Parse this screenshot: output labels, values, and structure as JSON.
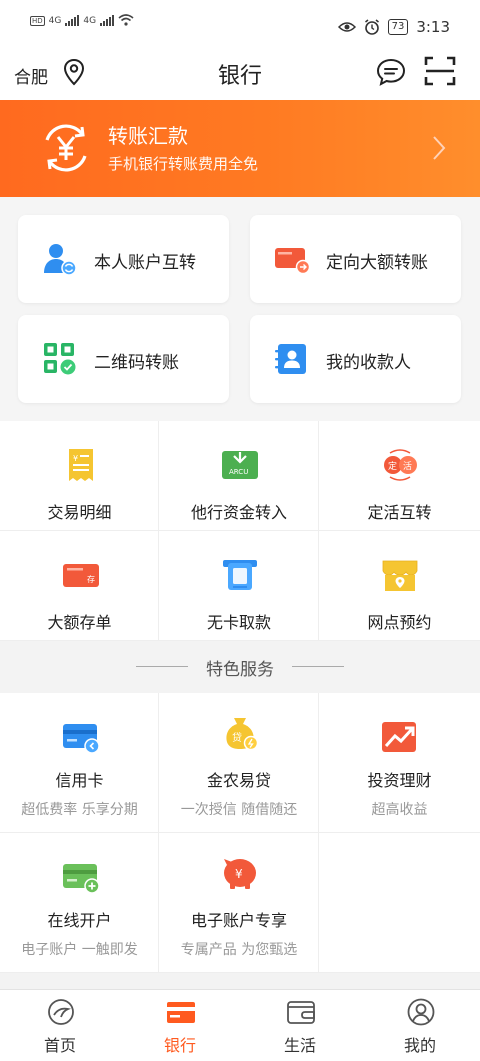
{
  "status_bar": {
    "net1": "4G",
    "net2": "4G",
    "battery": "73",
    "time": "3:13"
  },
  "header": {
    "city": "合肥",
    "title": "银行"
  },
  "banner": {
    "title": "转账汇款",
    "subtitle": "手机银行转账费用全免"
  },
  "transfer_cards": [
    {
      "label": "本人账户互转",
      "icon": "person-transfer-icon"
    },
    {
      "label": "定向大额转账",
      "icon": "large-transfer-card-icon"
    },
    {
      "label": "二维码转账",
      "icon": "qr-code-icon"
    },
    {
      "label": "我的收款人",
      "icon": "payee-contact-icon"
    }
  ],
  "services": [
    {
      "label": "交易明细",
      "icon": "receipt-icon"
    },
    {
      "label": "他行资金转入",
      "icon": "arcu-inflow-icon"
    },
    {
      "label": "定活互转",
      "icon": "fixed-current-swap-icon"
    },
    {
      "label": "大额存单",
      "icon": "deposit-certificate-icon"
    },
    {
      "label": "无卡取款",
      "icon": "cardless-withdraw-icon"
    },
    {
      "label": "网点预约",
      "icon": "branch-store-icon"
    }
  ],
  "featured": {
    "heading": "特色服务",
    "items": [
      {
        "label": "信用卡",
        "desc": "超低费率 乐享分期",
        "icon": "credit-card-icon"
      },
      {
        "label": "金农易贷",
        "desc": "一次授信 随借随还",
        "icon": "loan-bag-icon"
      },
      {
        "label": "投资理财",
        "desc": "超高收益",
        "icon": "investment-chart-icon"
      },
      {
        "label": "在线开户",
        "desc": "电子账户 一触即发",
        "icon": "open-account-icon"
      },
      {
        "label": "电子账户专享",
        "desc": "专属产品 为您甄选",
        "icon": "piggy-bank-icon"
      }
    ]
  },
  "bottom_nav": [
    {
      "label": "首页",
      "icon": "home-icon",
      "active": false
    },
    {
      "label": "银行",
      "icon": "bank-card-icon",
      "active": true
    },
    {
      "label": "生活",
      "icon": "wallet-icon",
      "active": false
    },
    {
      "label": "我的",
      "icon": "user-icon",
      "active": false
    }
  ],
  "colors": {
    "accent": "#ff5a1f",
    "banner_start": "#ff6a1f",
    "banner_end": "#ff8e2c"
  }
}
